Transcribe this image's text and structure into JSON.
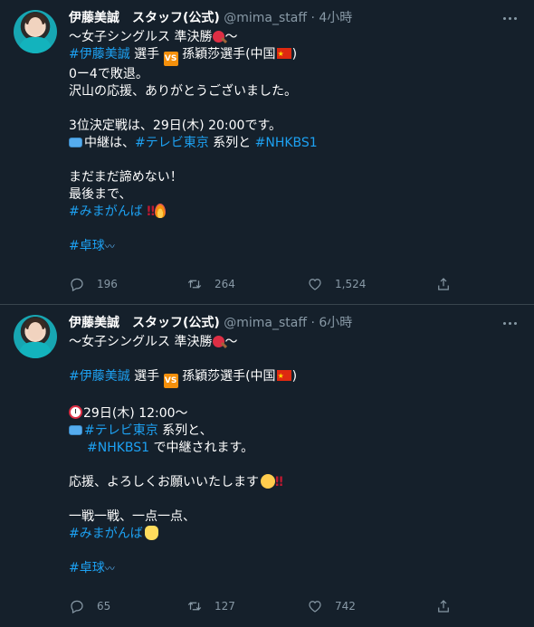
{
  "tweets": [
    {
      "name": "伊藤美誠　スタッフ(公式)",
      "handle": "@mima_staff",
      "dot": "·",
      "time": "4小時",
      "lines": [
        "〜女子シングルス 準決勝",
        "〜",
        "#伊藤美誠",
        " 選手 ",
        " 孫穎莎選手(中国",
        ")",
        "0ー4で敗退。",
        "沢山の応援、ありがとうございました。",
        "3位決定戦は、29日(木) 20:00です。",
        "中継は、",
        "#テレビ東京",
        " 系列と ",
        "#NHKBS1",
        "まだまだ諦めない！",
        "最後まで、",
        "#みまがんば",
        "‼",
        "#卓球"
      ],
      "vs_label": "VS",
      "counts": {
        "reply": "196",
        "retweet": "264",
        "like": "1,524"
      }
    },
    {
      "name": "伊藤美誠　スタッフ(公式)",
      "handle": "@mima_staff",
      "dot": "·",
      "time": "6小時",
      "lines": [
        "〜女子シングルス 準決勝",
        "〜",
        "#伊藤美誠",
        " 選手 ",
        " 孫穎莎選手(中国",
        ")",
        "29日(木) 12:00〜",
        "#テレビ東京",
        " 系列と、",
        "#NHKBS1",
        " で中継されます。",
        "応援、よろしくお願いいたします",
        "‼",
        "一戦一戦、一点一点、",
        "#みまがんば",
        "#卓球"
      ],
      "vs_label": "VS",
      "counts": {
        "reply": "65",
        "retweet": "127",
        "like": "742"
      }
    }
  ],
  "icons": [
    "more-icon",
    "reply-icon",
    "retweet-icon",
    "like-icon",
    "share-icon"
  ],
  "colors": {
    "background": "#15202b",
    "link": "#1da1f2",
    "muted": "#8899a6",
    "divider": "#38444d"
  }
}
